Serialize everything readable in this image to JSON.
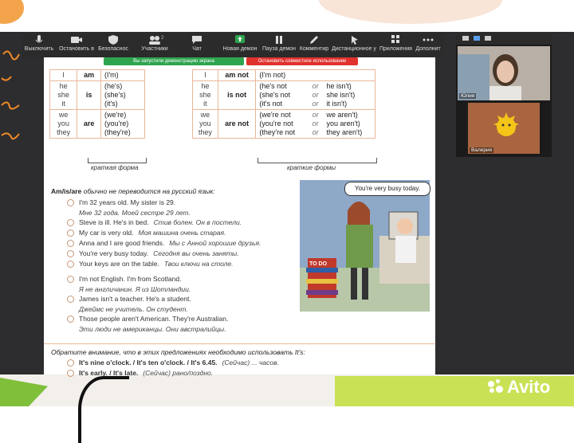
{
  "toolbar": {
    "items": [
      {
        "label": "Выключить",
        "icon": "microphone-icon"
      },
      {
        "label": "Остановить в",
        "icon": "video-camera-icon"
      },
      {
        "label": "Безопаснос",
        "icon": "shield-icon"
      },
      {
        "label": "Участники",
        "icon": "participants-icon",
        "badge": "2"
      },
      {
        "label": "Чат",
        "icon": "chat-icon"
      },
      {
        "label": "Новая демон",
        "icon": "share-screen-icon"
      },
      {
        "label": "Пауза демон",
        "icon": "pause-icon"
      },
      {
        "label": "Комментир",
        "icon": "annotate-icon"
      },
      {
        "label": "Дистанционное у",
        "icon": "remote-control-icon"
      },
      {
        "label": "Приложения",
        "icon": "apps-icon"
      },
      {
        "label": "Дополнит",
        "icon": "more-icon"
      }
    ]
  },
  "banners": {
    "demo": "Вы запустили демонстрацию экрана",
    "stop": "Остановить совместное использование"
  },
  "table_affirm": {
    "rows": [
      {
        "pronouns": [
          "I"
        ],
        "verb": "am",
        "forms": [
          "(I'm)"
        ]
      },
      {
        "pronouns": [
          "he",
          "she",
          "it"
        ],
        "verb": "is",
        "forms": [
          "(he's)",
          "(she's)",
          "(it's)"
        ]
      },
      {
        "pronouns": [
          "we",
          "you",
          "they"
        ],
        "verb": "are",
        "forms": [
          "(we're)",
          "(you're)",
          "(they're)"
        ]
      }
    ],
    "caption": "краткая форма"
  },
  "table_neg": {
    "rows": [
      {
        "pronouns": [
          "I"
        ],
        "verb": "am not",
        "forms": [
          [
            "(I'm not)",
            "",
            ""
          ]
        ]
      },
      {
        "pronouns": [
          "he",
          "she",
          "it"
        ],
        "verb": "is not",
        "forms": [
          [
            "(he's not",
            "or",
            "he isn't)"
          ],
          [
            "(she's not",
            "or",
            "she isn't)"
          ],
          [
            "(it's not",
            "or",
            "it isn't)"
          ]
        ]
      },
      {
        "pronouns": [
          "we",
          "you",
          "they"
        ],
        "verb": "are not",
        "forms": [
          [
            "(we're not",
            "or",
            "we aren't)"
          ],
          [
            "(you're not",
            "or",
            "you aren't)"
          ],
          [
            "(they're not",
            "or",
            "they aren't)"
          ]
        ]
      }
    ],
    "caption": "краткие формы"
  },
  "section1": {
    "heading_bold": "Am/is/are",
    "heading_rest": " обычно не переводится на русский язык:",
    "examples": [
      {
        "en": "I'm 32 years old.  My sister is 29.",
        "ru": "",
        "tr": "Мне 32 года.  Моей сестре 29 лет."
      },
      {
        "en": "Steve is ill.  He's in bed.",
        "ru": "Стив болен.  Он в постели.",
        "tr": ""
      },
      {
        "en": "My car is very old.",
        "ru": "Моя машина очень старая.",
        "tr": ""
      },
      {
        "en": "Anna and I are good friends.",
        "ru": "Мы с Анной хорошие друзья.",
        "tr": ""
      },
      {
        "en": "You're very busy today.",
        "ru": "Сегодня вы очень заняты.",
        "tr": ""
      },
      {
        "en": "Your keys are on the table.",
        "ru": "Твои ключи на столе.",
        "tr": ""
      },
      {
        "en": "I'm not English.  I'm from Scotland.",
        "ru": "",
        "tr": "Я не англичанин.  Я из Шотландии."
      },
      {
        "en": "James isn't a teacher.  He's a student.",
        "ru": "",
        "tr": "Джеймс не учитель.  Он студент."
      },
      {
        "en": "Those people aren't American.  They're Australian.",
        "ru": "",
        "tr": "Эти люди не американцы.  Они австралийцы."
      }
    ]
  },
  "section2": {
    "heading": "Обратите внимание, что в этих предложениях необходимо использовать It's:",
    "examples": [
      {
        "en": "It's nine o'clock. / It's ten o'clock. / It's 6.45.",
        "ru": "(Сейчас) ... часов."
      },
      {
        "en": "It's early. / It's late.",
        "ru": "(Сейчас) рано/поздно."
      }
    ]
  },
  "illustration": {
    "speech": "You're very busy today.",
    "box_label": "TO DO"
  },
  "annotations": [
    "м,",
    "и",
    "ей",
    "ый"
  ],
  "videos": {
    "tile1_name": "Юлия",
    "tile2_name": "Валерия"
  },
  "watermark": "Avito",
  "colors": {
    "share_green": "#2ea44f",
    "stop_red": "#e0312d",
    "table_border": "#e8b79a",
    "annot_orange": "#f08a24"
  }
}
